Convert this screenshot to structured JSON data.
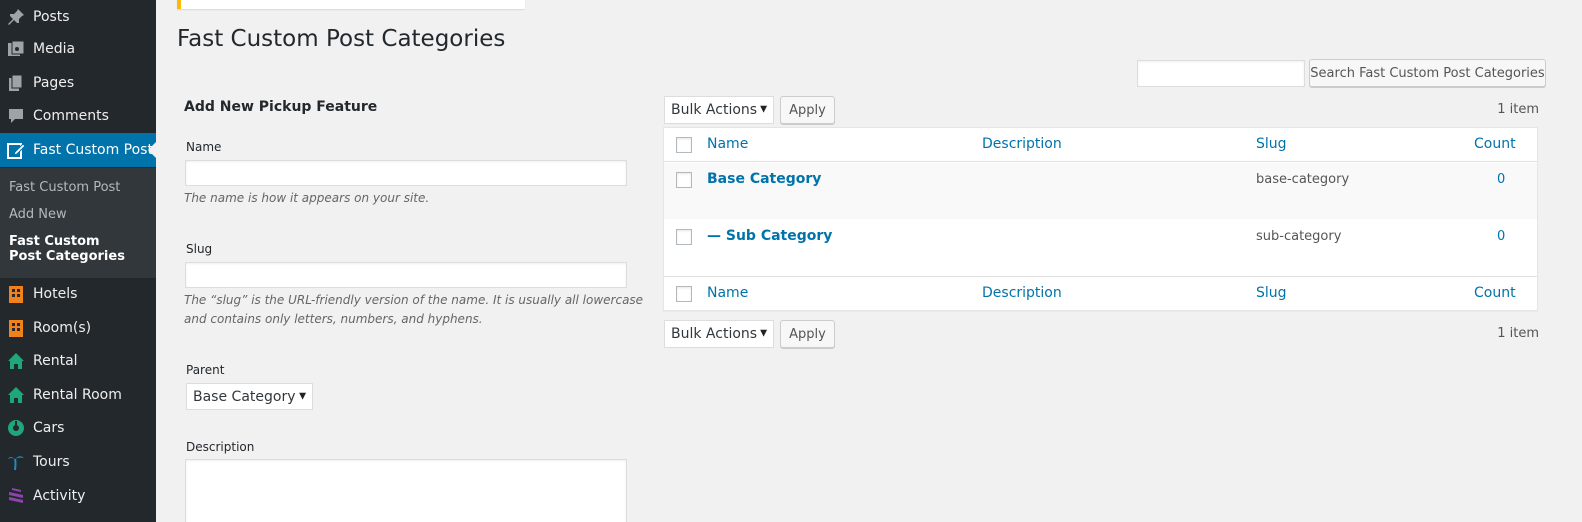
{
  "sidebar": {
    "items": [
      {
        "label": "Posts",
        "icon": "pin-icon",
        "color": "#9ea3a8"
      },
      {
        "label": "Media",
        "icon": "media-icon",
        "color": "#9ea3a8"
      },
      {
        "label": "Pages",
        "icon": "pages-icon",
        "color": "#9ea3a8"
      },
      {
        "label": "Comments",
        "icon": "comment-icon",
        "color": "#9ea3a8"
      },
      {
        "label": "Fast Custom Post",
        "icon": "edit-post-icon",
        "color": "#ffffff"
      },
      {
        "label": "Hotels",
        "icon": "building-icon",
        "color": "#f0821e"
      },
      {
        "label": "Room(s)",
        "icon": "building-icon",
        "color": "#f0821e"
      },
      {
        "label": "Rental",
        "icon": "home-icon",
        "color": "#1fa67a"
      },
      {
        "label": "Rental Room",
        "icon": "home-icon",
        "color": "#1fa67a"
      },
      {
        "label": "Cars",
        "icon": "car-icon",
        "color": "#1fa67a"
      },
      {
        "label": "Tours",
        "icon": "palm-icon",
        "color": "#1e8cbe"
      },
      {
        "label": "Activity",
        "icon": "activity-icon",
        "color": "#8e44ad"
      }
    ],
    "submenu": [
      {
        "label": "Fast Custom Post"
      },
      {
        "label": "Add New"
      },
      {
        "label": "Fast Custom Post Categories"
      }
    ]
  },
  "page": {
    "title": "Fast Custom Post Categories",
    "search_button": "Search Fast Custom Post Categories",
    "search_value": ""
  },
  "form": {
    "heading": "Add New Pickup Feature",
    "name_label": "Name",
    "name_hint": "The name is how it appears on your site.",
    "slug_label": "Slug",
    "slug_hint": "The “slug” is the URL-friendly version of the name. It is usually all lowercase and contains only letters, numbers, and hyphens.",
    "parent_label": "Parent",
    "parent_value": "Base Category",
    "description_label": "Description"
  },
  "list": {
    "bulk_actions": "Bulk Actions",
    "apply": "Apply",
    "count_text": "1 item",
    "columns": {
      "name": "Name",
      "description": "Description",
      "slug": "Slug",
      "count": "Count"
    },
    "rows": [
      {
        "name": "Base Category",
        "description": "",
        "slug": "base-category",
        "count": "0"
      },
      {
        "name": "— Sub Category",
        "description": "",
        "slug": "sub-category",
        "count": "0"
      }
    ]
  }
}
